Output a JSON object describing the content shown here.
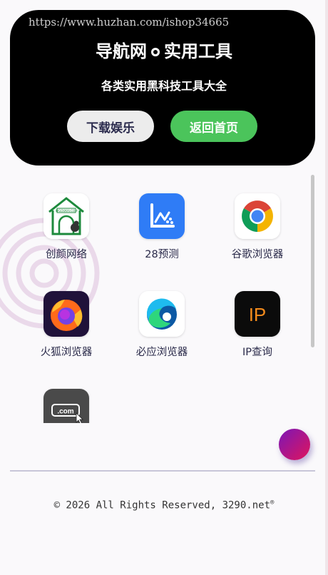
{
  "watermark": "https://www.huzhan.com/ishop34665",
  "header": {
    "title_left": "导航网",
    "title_right": "实用工具",
    "subtitle": "各类实用黑科技工具大全",
    "buttons": [
      {
        "label": "下载娱乐"
      },
      {
        "label": "返回首页"
      }
    ]
  },
  "apps": [
    {
      "label": "创颜网络",
      "icon": "house-icon",
      "icon_text": "IIYGOUKAI.COM"
    },
    {
      "label": "28预测",
      "icon": "chart-icon"
    },
    {
      "label": "谷歌浏览器",
      "icon": "chrome-icon"
    },
    {
      "label": "火狐浏览器",
      "icon": "firefox-icon"
    },
    {
      "label": "必应浏览器",
      "icon": "edge-icon"
    },
    {
      "label": "IP查询",
      "icon": "ip-icon",
      "icon_text": "IP"
    },
    {
      "label": "",
      "icon": "domain-icon",
      "icon_text": ".com"
    }
  ],
  "footer": {
    "text": "© 2026 All Rights Reserved, 3290.net",
    "mark": "®"
  },
  "colors": {
    "hero_bg": "#000000",
    "home_button": "#4bc45b",
    "download_button": "#ececec",
    "fab_gradient": [
      "#7b16b7",
      "#e0155c"
    ]
  }
}
